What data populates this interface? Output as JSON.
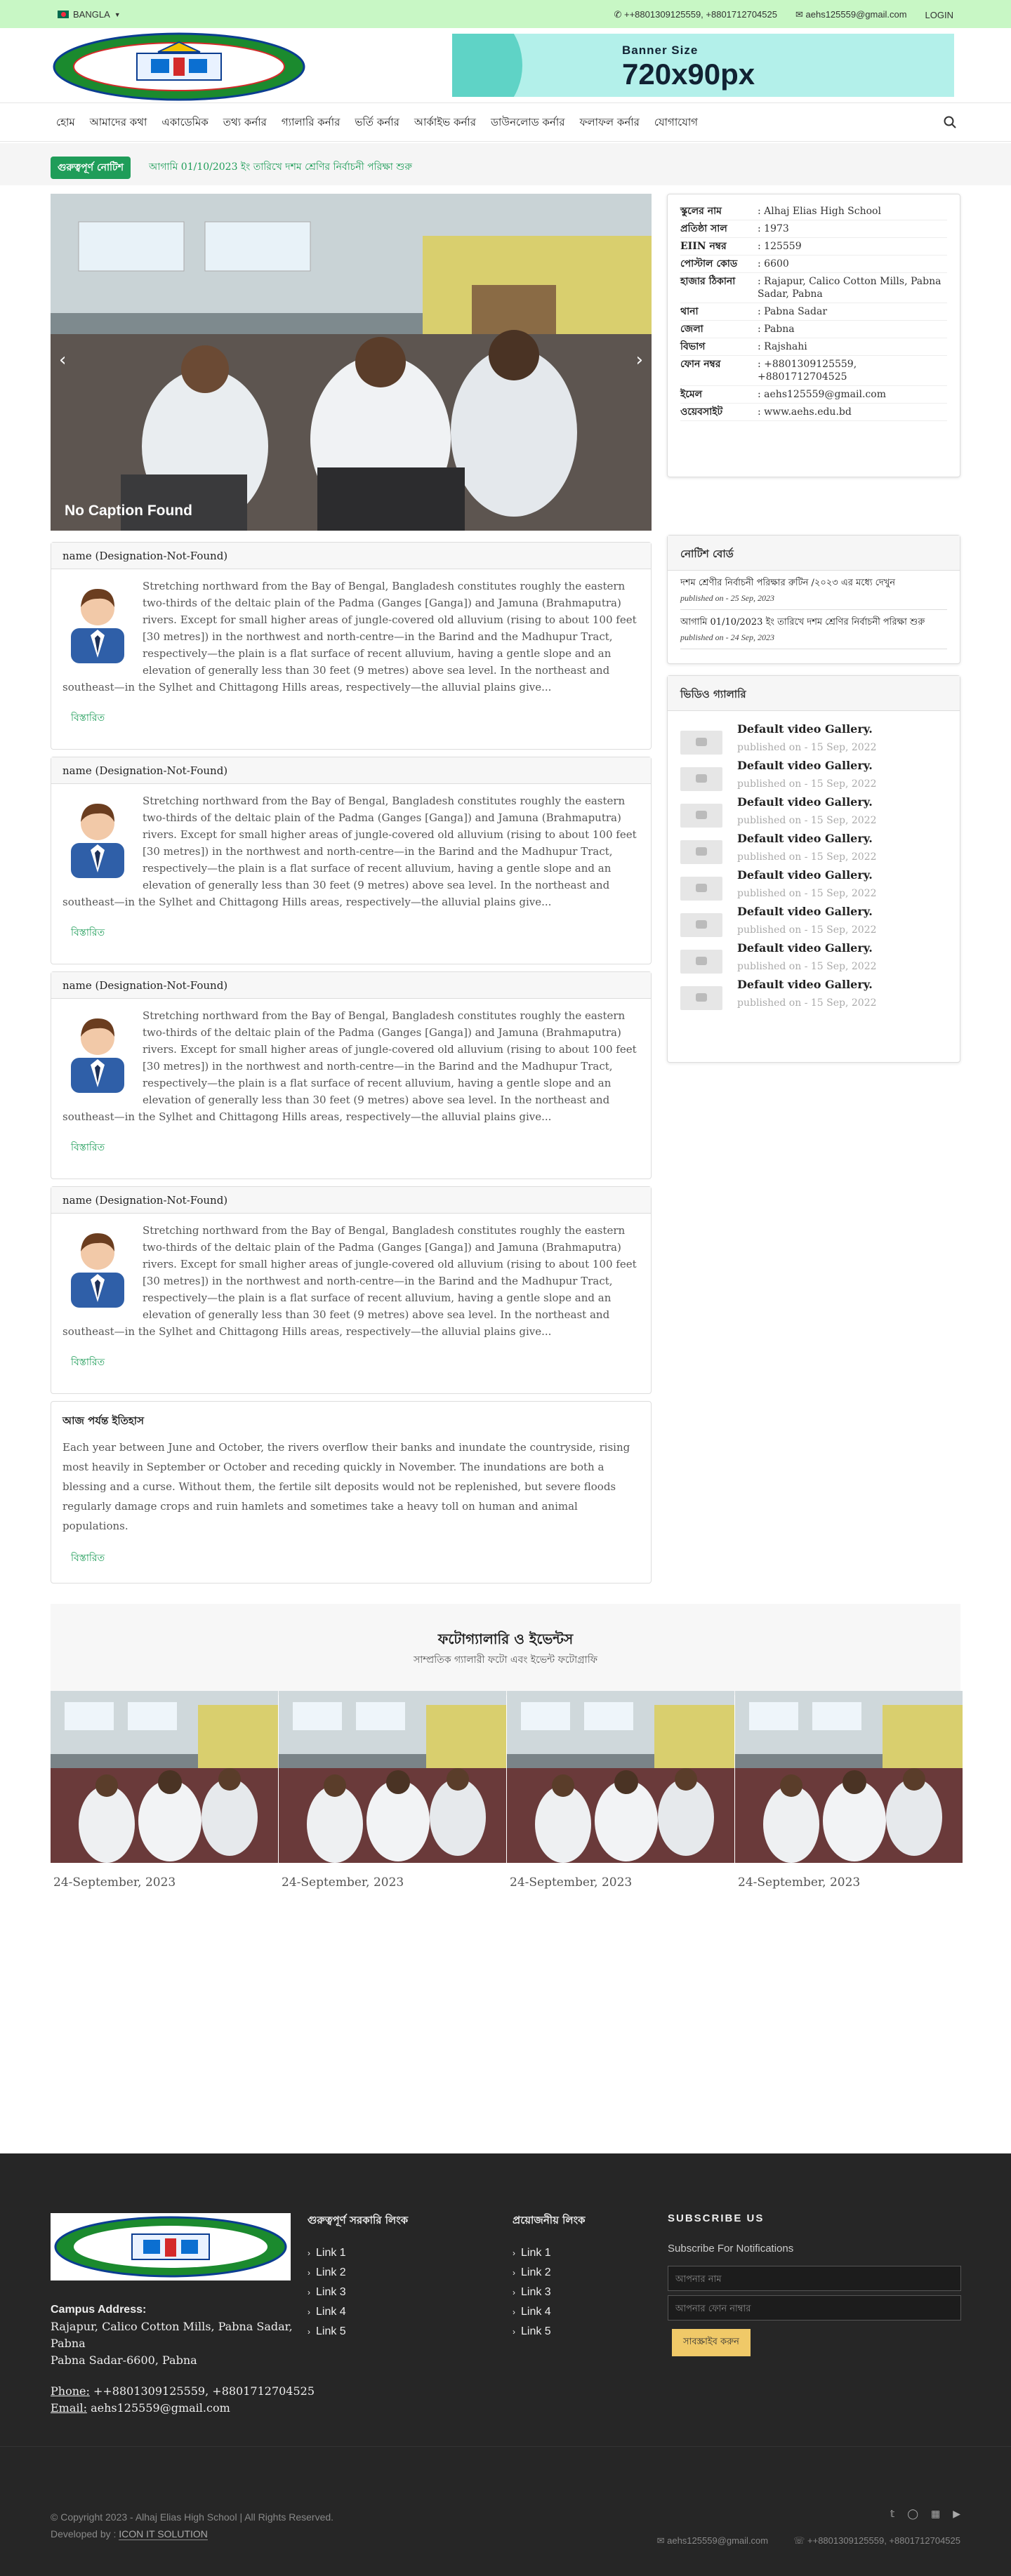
{
  "topbar": {
    "language": "BANGLA",
    "phones": "++8801309125559, +8801712704525",
    "email": "aehs125559@gmail.com",
    "login": "LOGIN"
  },
  "banner": {
    "title": "Banner Size",
    "size": "720x90px"
  },
  "nav": {
    "items": [
      "হোম",
      "আমাদের কথা",
      "একাডেমিক",
      "তথ্য কর্নার",
      "গ্যালারি কর্নার",
      "ভর্তি কর্নার",
      "আর্কাইভ কর্নার",
      "ডাউনলোড কর্নার",
      "ফলাফল কর্নার",
      "যোগাযোগ"
    ]
  },
  "notice": {
    "label": "গুরুত্বপূর্ণ নোটিশ",
    "text": "আগামি 01/10/2023 ইং তারিখে দশম শ্রেণির নির্বাচনী পরিক্ষা শুরু"
  },
  "slider": {
    "caption": "No Caption Found"
  },
  "school_info": [
    {
      "k": "স্কুলের নাম",
      "v": ": Alhaj Elias High School"
    },
    {
      "k": "প্রতিষ্ঠা সাল",
      "v": ": 1973"
    },
    {
      "k": "EIIN নম্বর",
      "v": ": 125559"
    },
    {
      "k": "পোস্টাল কোড",
      "v": ": 6600"
    },
    {
      "k": "হাজার ঠিকানা",
      "v": ": Rajapur, Calico Cotton Mills, Pabna Sadar, Pabna"
    },
    {
      "k": "থানা",
      "v": ": Pabna Sadar"
    },
    {
      "k": "জেলা",
      "v": ": Pabna"
    },
    {
      "k": "বিভাগ",
      "v": ": Rajshahi"
    },
    {
      "k": "ফোন নম্বর",
      "v": ": +8801309125559, +8801712704525"
    },
    {
      "k": "ইমেল",
      "v": ": aehs125559@gmail.com"
    },
    {
      "k": "ওয়েবসাইট",
      "v": ": www.aehs.edu.bd"
    }
  ],
  "messages": [
    {
      "name": "name (Designation-Not-Found)",
      "text": "Stretching northward from the Bay of Bengal, Bangladesh constitutes roughly the eastern two-thirds of the deltaic plain of the Padma (Ganges [Ganga]) and Jamuna (Brahmaputra) rivers. Except for small higher areas of jungle-covered old alluvium (rising to about 100 feet [30 metres]) in the northwest and north-centre—in the Barind and the Madhupur Tract, respectively—the plain is a flat surface of recent alluvium, having a gentle slope and an elevation of generally less than 30 feet (9 metres) above sea level. In the northeast and southeast—in the Sylhet and Chittagong Hills areas, respectively—the alluvial plains give...",
      "more": "বিস্তারিত"
    },
    {
      "name": "name (Designation-Not-Found)",
      "text": "Stretching northward from the Bay of Bengal, Bangladesh constitutes roughly the eastern two-thirds of the deltaic plain of the Padma (Ganges [Ganga]) and Jamuna (Brahmaputra) rivers. Except for small higher areas of jungle-covered old alluvium (rising to about 100 feet [30 metres]) in the northwest and north-centre—in the Barind and the Madhupur Tract, respectively—the plain is a flat surface of recent alluvium, having a gentle slope and an elevation of generally less than 30 feet (9 metres) above sea level. In the northeast and southeast—in the Sylhet and Chittagong Hills areas, respectively—the alluvial plains give...",
      "more": "বিস্তারিত"
    },
    {
      "name": "name (Designation-Not-Found)",
      "text": "Stretching northward from the Bay of Bengal, Bangladesh constitutes roughly the eastern two-thirds of the deltaic plain of the Padma (Ganges [Ganga]) and Jamuna (Brahmaputra) rivers. Except for small higher areas of jungle-covered old alluvium (rising to about 100 feet [30 metres]) in the northwest and north-centre—in the Barind and the Madhupur Tract, respectively—the plain is a flat surface of recent alluvium, having a gentle slope and an elevation of generally less than 30 feet (9 metres) above sea level. In the northeast and southeast—in the Sylhet and Chittagong Hills areas, respectively—the alluvial plains give...",
      "more": "বিস্তারিত"
    },
    {
      "name": "name (Designation-Not-Found)",
      "text": "Stretching northward from the Bay of Bengal, Bangladesh constitutes roughly the eastern two-thirds of the deltaic plain of the Padma (Ganges [Ganga]) and Jamuna (Brahmaputra) rivers. Except for small higher areas of jungle-covered old alluvium (rising to about 100 feet [30 metres]) in the northwest and north-centre—in the Barind and the Madhupur Tract, respectively—the plain is a flat surface of recent alluvium, having a gentle slope and an elevation of generally less than 30 feet (9 metres) above sea level. In the northeast and southeast—in the Sylhet and Chittagong Hills areas, respectively—the alluvial plains give...",
      "more": "বিস্তারিত"
    }
  ],
  "history": {
    "title": "আজ পর্যন্ত ইতিহাস",
    "text": "Each year between June and October, the rivers overflow their banks and inundate the countryside, rising most heavily in September or October and receding quickly in November. The inundations are both a blessing and a curse. Without them, the fertile silt deposits would not be replenished, but severe floods regularly damage crops and ruin hamlets and sometimes take a heavy toll on human and animal populations.",
    "more": "বিস্তারিত"
  },
  "notices": {
    "title": "নোটিশ বোর্ড",
    "items": [
      {
        "text": "দশম শ্রেণীর নির্বাচনী পরিক্ষার রুটিন /২০২৩ এর মধ্যে দেখুন",
        "date": "published on - 25 Sep, 2023"
      },
      {
        "text": "আগামি 01/10/2023 ইং তারিখে দশম শ্রেণির নির্বাচনী পরিক্ষা শুরু",
        "date": "published on - 24 Sep, 2023"
      }
    ]
  },
  "videos": {
    "title": "ভিডিও গ্যালারি",
    "items": [
      {
        "title": "Default video Gallery.",
        "date": "published on - 15 Sep, 2022"
      },
      {
        "title": "Default video Gallery.",
        "date": "published on - 15 Sep, 2022"
      },
      {
        "title": "Default video Gallery.",
        "date": "published on - 15 Sep, 2022"
      },
      {
        "title": "Default video Gallery.",
        "date": "published on - 15 Sep, 2022"
      },
      {
        "title": "Default video Gallery.",
        "date": "published on - 15 Sep, 2022"
      },
      {
        "title": "Default video Gallery.",
        "date": "published on - 15 Sep, 2022"
      },
      {
        "title": "Default video Gallery.",
        "date": "published on - 15 Sep, 2022"
      },
      {
        "title": "Default video Gallery.",
        "date": "published on - 15 Sep, 2022"
      }
    ]
  },
  "gallery": {
    "title": "ফটোগ্যালারি ও ইভেন্টস",
    "subtitle": "সাম্প্রতিক গ্যালারী ফটো এবং ইভেন্ট ফটোগ্রাফি",
    "dates": [
      "24-September, 2023",
      "24-September, 2023",
      "24-September, 2023",
      "24-September, 2023"
    ]
  },
  "footer": {
    "campus_label": "Campus Address:",
    "address1": "Rajapur, Calico Cotton Mills, Pabna Sadar,",
    "address2": "Pabna",
    "address3": "Pabna Sadar-6600, Pabna",
    "phone_label": "Phone:",
    "phone": " ++8801309125559, +8801712704525",
    "email_label": "Email:",
    "email": " aehs125559@gmail.com",
    "col1_title": "গুরুত্বপূর্ণ সরকারি লিংক",
    "col2_title": "প্রয়োজনীয় লিংক",
    "links": [
      "Link 1",
      "Link 2",
      "Link 3",
      "Link 4",
      "Link 5"
    ],
    "subscribe_title": "SUBSCRIBE US",
    "subscribe_text": "Subscribe For Notifications",
    "name_placeholder": "আপনার নাম",
    "phone_placeholder": "আপনার ফোন নাম্বার",
    "subscribe_btn": "সাবস্ক্রাইব করুন",
    "copyright": "© Copyright 2023 - Alhaj Elias High School | All Rights Reserved.",
    "dev_label": "Developed by :",
    "developer": "ICON IT SOLUTION",
    "bottom_email": "aehs125559@gmail.com",
    "bottom_phone": "++8801309125559, +8801712704525"
  },
  "colors": {
    "accent": "#1f9d59",
    "topbar": "#c8f7c5",
    "footer": "#262626"
  }
}
